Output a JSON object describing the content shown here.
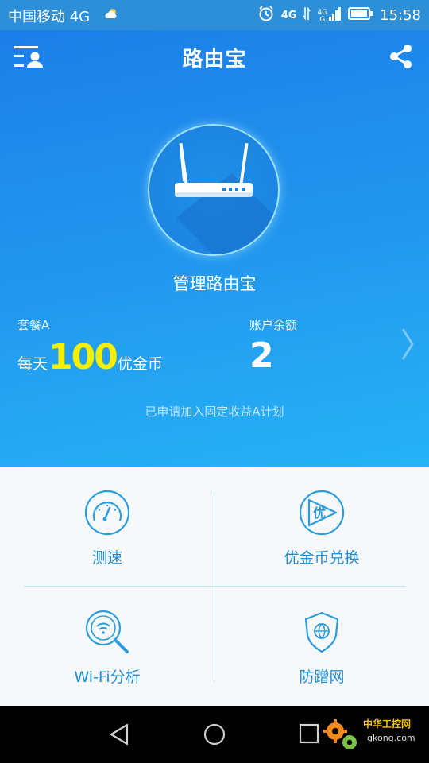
{
  "status_bar": {
    "carrier": "中国移动 4G",
    "network_a": "4G",
    "network_b": "4G",
    "network_c": "G",
    "time": "15:58"
  },
  "header": {
    "title": "路由宝"
  },
  "router": {
    "name": "管理路由宝"
  },
  "plan": {
    "label": "套餐A",
    "prefix": "每天",
    "amount": "100",
    "suffix": "优金币"
  },
  "balance": {
    "label": "账户余额",
    "value": "2"
  },
  "enrolled_note": "已申请加入固定收益A计划",
  "features": [
    {
      "label": "测速",
      "icon": "speedometer-icon"
    },
    {
      "label": "优金币兑换",
      "icon": "coin-exchange-icon"
    },
    {
      "label": "Wi-Fi分析",
      "icon": "wifi-search-icon"
    },
    {
      "label": "防蹭网",
      "icon": "shield-globe-icon"
    }
  ],
  "watermark": {
    "line1": "中华工控网",
    "line2": "gkong.com"
  },
  "colors": {
    "hero_top": "#1c7fe8",
    "hero_bottom": "#26b3f5",
    "accent_text": "#1e8fd6",
    "highlight_number": "#f4f000"
  }
}
